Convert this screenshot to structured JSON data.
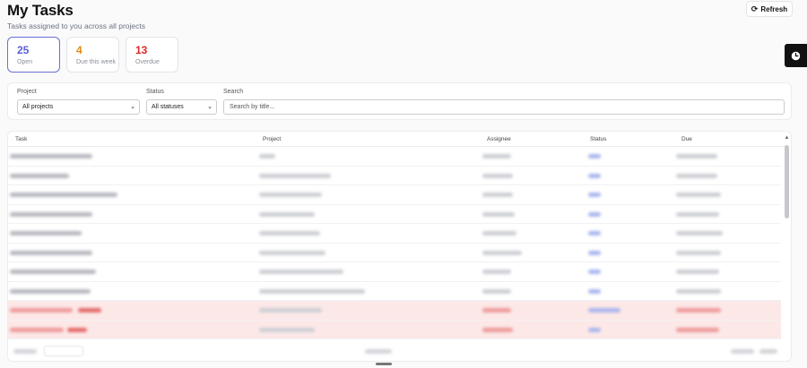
{
  "header": {
    "title": "My Tasks",
    "subtitle": "Tasks assigned to you across all projects"
  },
  "toolbar": {
    "refresh_label": "Refresh",
    "refresh_icon": "refresh-icon"
  },
  "side_tab": {
    "icon": "clock-icon"
  },
  "stats": [
    {
      "value": "25",
      "label": "Open",
      "color": "#5b5fd6",
      "active": true
    },
    {
      "value": "4",
      "label": "Due this week",
      "color": "#e08a12",
      "active": false
    },
    {
      "value": "13",
      "label": "Overdue",
      "color": "#dc2626",
      "active": false
    }
  ],
  "filters": {
    "project": {
      "label": "Project",
      "value": "All projects"
    },
    "status": {
      "label": "Status",
      "value": "All statuses"
    },
    "search": {
      "label": "Search",
      "placeholder": "Search by title..."
    }
  },
  "table": {
    "columns": [
      "Task",
      "Project",
      "Assignee",
      "Status",
      "Due"
    ],
    "row_count_visible": 10,
    "overdue_rows": 2
  },
  "colors": {
    "accent": "#6c6fd6",
    "overdue_row": "#fde8e8",
    "status_link": "#a9b6ee"
  }
}
